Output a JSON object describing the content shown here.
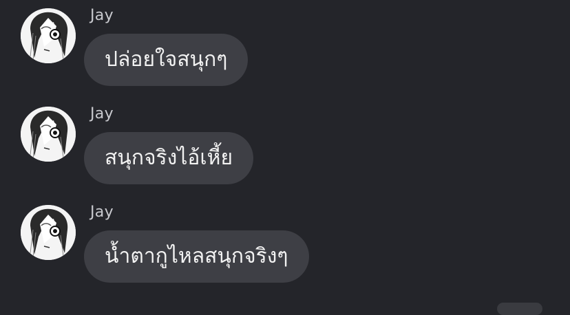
{
  "messages": [
    {
      "sender": "Jay",
      "text": "ปล่อยใจสนุกๆ"
    },
    {
      "sender": "Jay",
      "text": "สนุกจริงไอ้เหี้ย"
    },
    {
      "sender": "Jay",
      "text": "น้ำตากูไหลสนุกจริงๆ"
    }
  ],
  "colors": {
    "background": "#24252a",
    "bubble": "#3e3f45",
    "text": "#f2f2f2",
    "sender": "#c9cacf"
  }
}
